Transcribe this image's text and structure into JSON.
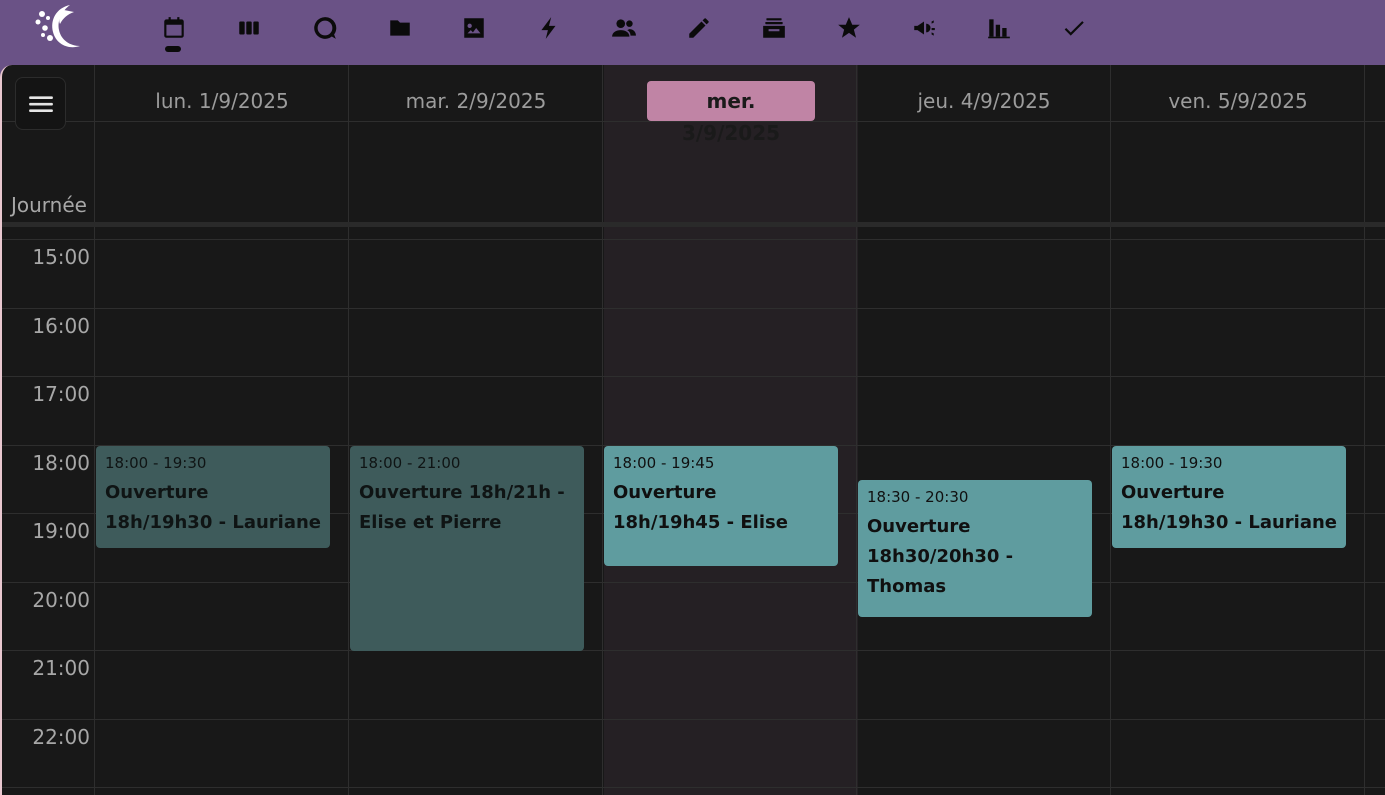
{
  "nav": {
    "icons": [
      "calendar-icon",
      "columns-icon",
      "chat-icon",
      "folder-icon",
      "image-icon",
      "lightning-icon",
      "users-icon",
      "pencil-icon",
      "inbox-stack-icon",
      "star-icon",
      "megaphone-icon",
      "bar-chart-icon",
      "check-icon"
    ],
    "active": "calendar-icon"
  },
  "calendar": {
    "days": [
      {
        "label": "lun. 1/9/2025",
        "today": false
      },
      {
        "label": "mar. 2/9/2025",
        "today": false
      },
      {
        "label": "mer. 3/9/2025",
        "today": true
      },
      {
        "label": "jeu. 4/9/2025",
        "today": false
      },
      {
        "label": "ven. 5/9/2025",
        "today": false
      }
    ],
    "allday_label": "Journée",
    "hours": [
      "15:00",
      "16:00",
      "17:00",
      "18:00",
      "19:00",
      "20:00",
      "21:00",
      "22:00"
    ],
    "events": [
      {
        "day": 0,
        "start": "18:00",
        "end": "19:30",
        "time": "18:00 - 19:30",
        "title": "Ouverture 18h/19h30 - Lauriane",
        "past": true
      },
      {
        "day": 1,
        "start": "18:00",
        "end": "21:00",
        "time": "18:00 - 21:00",
        "title": "Ouverture 18h/21h - Elise et Pierre",
        "past": true
      },
      {
        "day": 2,
        "start": "18:00",
        "end": "19:45",
        "time": "18:00 - 19:45",
        "title": "Ouverture 18h/19h45 - Elise",
        "past": false
      },
      {
        "day": 3,
        "start": "18:30",
        "end": "20:30",
        "time": "18:30 - 20:30",
        "title": "Ouverture 18h30/20h30 - Thomas",
        "past": false
      },
      {
        "day": 4,
        "start": "18:00",
        "end": "19:30",
        "time": "18:00 - 19:30",
        "title": "Ouverture 18h/19h30 - Lauriane",
        "past": false
      }
    ]
  },
  "colors": {
    "nav_bg": "#6a5286",
    "today_badge": "#c084a5",
    "event_past": "#3e5b5b",
    "event_future": "#5f9c9f"
  }
}
